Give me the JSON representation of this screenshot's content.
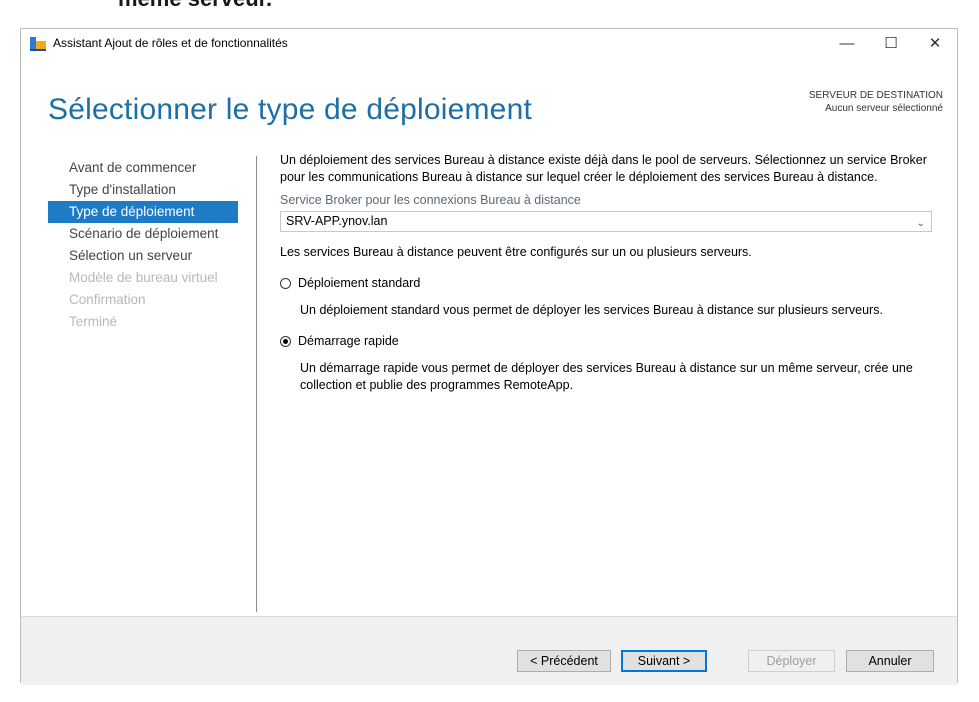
{
  "background": {
    "cut_text": "même serveur."
  },
  "window": {
    "title": "Assistant Ajout de rôles et de fonctionnalités",
    "controls": {
      "minimize": "—",
      "maximize": "☐",
      "close": "✕"
    }
  },
  "header": {
    "title": "Sélectionner le type de déploiement",
    "dest_label": "SERVEUR DE DESTINATION",
    "dest_value": "Aucun serveur sélectionné"
  },
  "nav": {
    "items": [
      {
        "label": "Avant de commencer",
        "state": "normal"
      },
      {
        "label": "Type d'installation",
        "state": "normal"
      },
      {
        "label": "Type de déploiement",
        "state": "active"
      },
      {
        "label": "Scénario de déploiement",
        "state": "normal"
      },
      {
        "label": "Sélection un serveur",
        "state": "normal"
      },
      {
        "label": "Modèle de bureau virtuel",
        "state": "disabled"
      },
      {
        "label": "Confirmation",
        "state": "disabled"
      },
      {
        "label": "Terminé",
        "state": "disabled"
      }
    ]
  },
  "content": {
    "intro": "Un déploiement des services Bureau à distance existe déjà dans le pool de serveurs. Sélectionnez un service Broker pour les communications Bureau à distance sur lequel créer le déploiement des services Bureau à distance.",
    "broker_label": "Service Broker pour les connexions Bureau à distance",
    "broker_value": "SRV-APP.ynov.lan",
    "config_text": "Les services Bureau à distance peuvent être configurés sur un ou plusieurs serveurs.",
    "option_standard": {
      "label": "Déploiement standard",
      "checked": false,
      "desc": "Un déploiement standard vous permet de déployer les services Bureau à distance sur plusieurs serveurs."
    },
    "option_quick": {
      "label": "Démarrage rapide",
      "checked": true,
      "desc": "Un démarrage rapide vous permet de déployer des services Bureau à distance sur un même serveur, crée une collection et publie des programmes RemoteApp."
    }
  },
  "footer": {
    "prev": "< Précédent",
    "next": "Suivant >",
    "deploy": "Déployer",
    "cancel": "Annuler"
  },
  "colors": {
    "accent": "#1e7cc6",
    "title_blue": "#1d6fa5"
  }
}
